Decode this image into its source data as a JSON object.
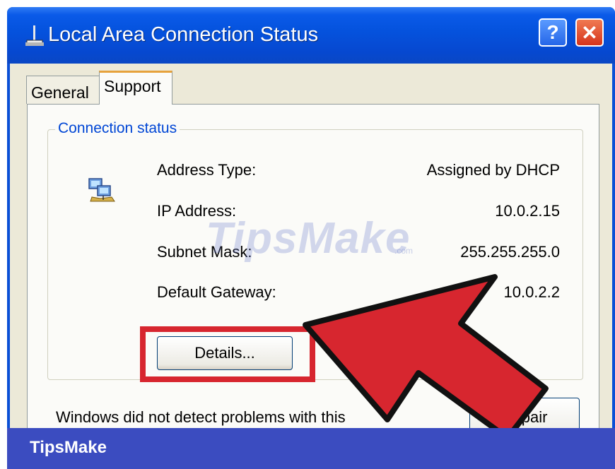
{
  "window": {
    "title": "Local Area Connection Status",
    "help_label": "?",
    "close_label": "✕"
  },
  "tabs": [
    {
      "label": "General"
    },
    {
      "label": "Support"
    }
  ],
  "connection_status": {
    "legend": "Connection status",
    "rows": [
      {
        "label": "Address Type:",
        "value": "Assigned by DHCP"
      },
      {
        "label": "IP Address:",
        "value": "10.0.2.15"
      },
      {
        "label": "Subnet Mask:",
        "value": "255.255.255.0"
      },
      {
        "label": "Default Gateway:",
        "value": "10.0.2.2"
      }
    ],
    "details_label": "Details..."
  },
  "footer": {
    "message": "Windows did not detect problems with this",
    "repair_label": "Repair"
  },
  "watermark": {
    "text": "TipsMake",
    "suffix": ".com"
  },
  "brand": {
    "name": "TipsMake"
  },
  "colors": {
    "titlebar": "#0553de",
    "legend": "#0046d5",
    "highlight": "#d7262f",
    "brand_bar": "#3b4cc0"
  },
  "icons": {
    "title": "network-connection-icon",
    "status": "network-computers-icon"
  }
}
